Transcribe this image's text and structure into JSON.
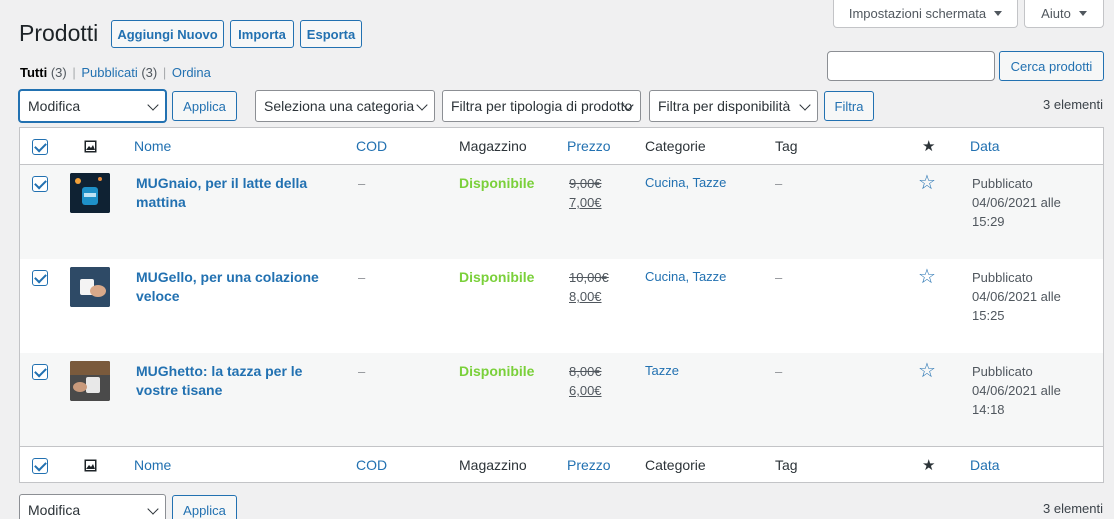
{
  "screen_options_label": "Impostazioni schermata",
  "help_label": "Aiuto",
  "page_title": "Prodotti",
  "header_buttons": {
    "add_new": "Aggiungi Nuovo",
    "import": "Importa",
    "export": "Esporta"
  },
  "subsubsub": {
    "all": "Tutti",
    "all_count": "(3)",
    "published": "Pubblicati",
    "published_count": "(3)",
    "sort": "Ordina",
    "sep": "|"
  },
  "search": {
    "value": "",
    "button": "Cerca prodotti"
  },
  "top_nav": {
    "bulk_action": "Modifica",
    "apply": "Applica",
    "category": "Seleziona una categoria",
    "type_filter": "Filtra per tipologia di prodotto",
    "stock_filter": "Filtra per disponibilità",
    "filter_button": "Filtra",
    "count": "3 elementi"
  },
  "columns": {
    "name": "Nome",
    "sku": "COD",
    "stock": "Magazzino",
    "price": "Prezzo",
    "categories": "Categorie",
    "tags": "Tag",
    "date": "Data"
  },
  "products": [
    {
      "name": "MUGnaio, per il latte della mattina",
      "sku": "–",
      "stock": "Disponibile",
      "regular_price": "9,00€",
      "sale_price": "7,00€",
      "categories": "Cucina, Tazze",
      "tags": "–",
      "status": "Pubblicato",
      "date": "04/06/2021 alle",
      "time": "15:29",
      "thumb_icon": "mug-fuel-thumbnail"
    },
    {
      "name": "MUGello, per una colazione veloce",
      "sku": "–",
      "stock": "Disponibile",
      "regular_price": "10,00€",
      "sale_price": "8,00€",
      "categories": "Cucina, Tazze",
      "tags": "–",
      "status": "Pubblicato",
      "date": "04/06/2021 alle",
      "time": "15:25",
      "thumb_icon": "mug-hand-thumbnail"
    },
    {
      "name": "MUGhetto: la tazza per le vostre tisane",
      "sku": "–",
      "stock": "Disponibile",
      "regular_price": "8,00€",
      "sale_price": "6,00€",
      "categories": "Tazze",
      "tags": "–",
      "status": "Pubblicato",
      "date": "04/06/2021 alle",
      "time": "14:18",
      "thumb_icon": "mug-table-thumbnail"
    }
  ],
  "bottom_nav": {
    "bulk_action": "Modifica",
    "apply": "Applica",
    "count": "3 elementi"
  },
  "colors": {
    "accent": "#2271b1",
    "in_stock": "#7ad03a",
    "background": "#f0f0f1"
  },
  "icons": {
    "image_column": "image-icon",
    "featured_column": "star-filled-icon",
    "featured_toggle": "star-outline-icon"
  }
}
